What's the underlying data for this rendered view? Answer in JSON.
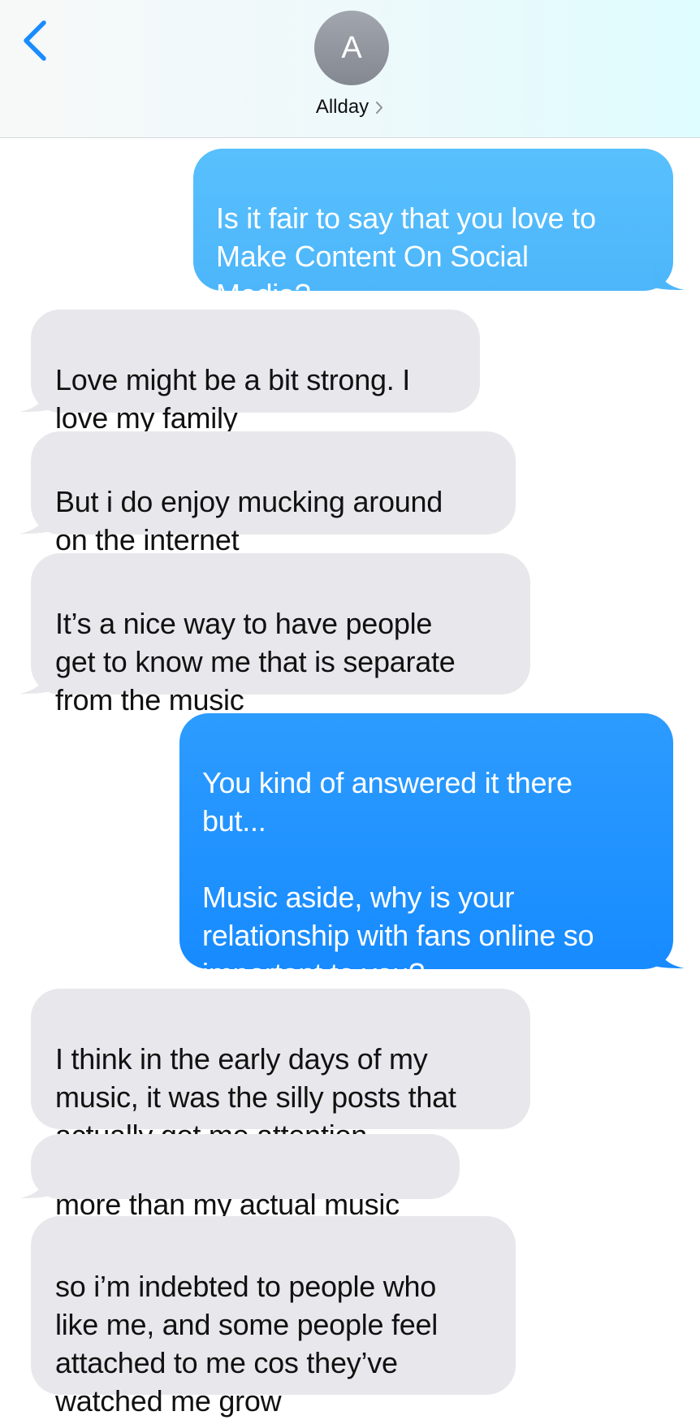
{
  "header": {
    "contact_initial": "A",
    "contact_name": "Allday",
    "back_icon": "chevron-left-icon",
    "name_chevron_icon": "chevron-right-icon"
  },
  "colors": {
    "outgoing_light": "#4db6fb",
    "outgoing_dark": "#178bff",
    "incoming": "#e8e8ec",
    "accent": "#1a8cff"
  },
  "messages": [
    {
      "direction": "outgoing",
      "text": "Is it fair to say that you love to\nMake Content On Social\nMedia?"
    },
    {
      "direction": "incoming",
      "text": "Love might be a bit strong. I\nlove my family"
    },
    {
      "direction": "incoming",
      "text": "But i do enjoy mucking around\non the internet"
    },
    {
      "direction": "incoming",
      "text": "It’s a nice way to have people\nget to know me that is separate\nfrom the music"
    },
    {
      "direction": "outgoing",
      "text": "You kind of answered it there\nbut...\n\nMusic aside, why is your\nrelationship with fans online so\nimportant to you?"
    },
    {
      "direction": "incoming",
      "text": "I think in the early days of my\nmusic, it was the silly posts that\nactually got me attention"
    },
    {
      "direction": "incoming",
      "text": "more than my actual music"
    },
    {
      "direction": "incoming",
      "text": "so i’m indebted to people who\nlike me, and some people feel\nattached to me cos they’ve\nwatched me grow"
    }
  ]
}
